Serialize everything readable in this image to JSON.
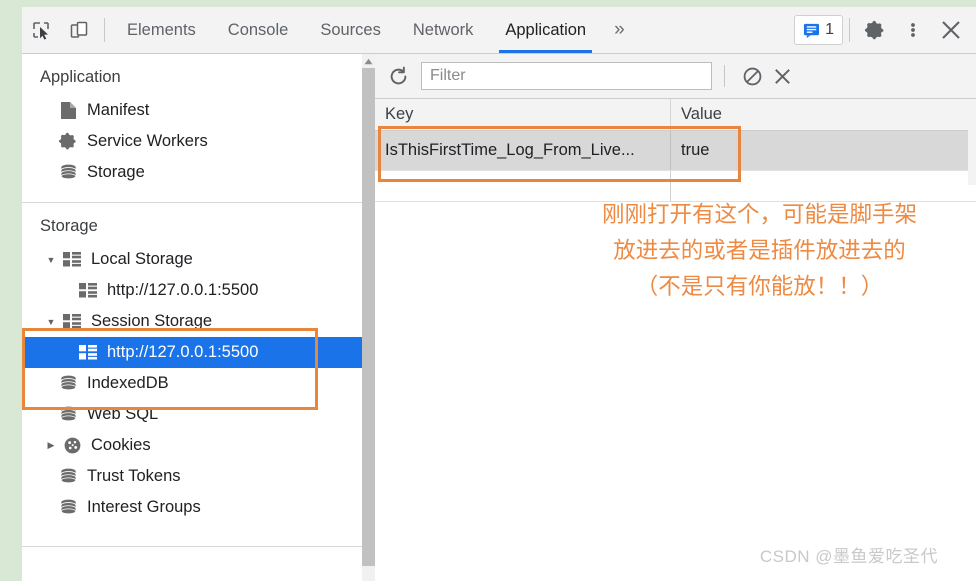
{
  "tabbar": {
    "icons": [
      {
        "name": "inspect-element-icon"
      },
      {
        "name": "device-toolbar-icon"
      }
    ],
    "tabs": [
      {
        "label": "Elements",
        "active": false
      },
      {
        "label": "Console",
        "active": false
      },
      {
        "label": "Sources",
        "active": false
      },
      {
        "label": "Network",
        "active": false
      },
      {
        "label": "Application",
        "active": true
      }
    ],
    "more_tabs_glyph": "»",
    "issues_count": "1",
    "right_icons": [
      {
        "name": "settings-gear-icon"
      },
      {
        "name": "more-options-icon"
      },
      {
        "name": "close-devtools-icon"
      }
    ]
  },
  "sidebar": {
    "application_title": "Application",
    "application_items": [
      {
        "label": "Manifest",
        "icon": "manifest-file-icon"
      },
      {
        "label": "Service Workers",
        "icon": "gear-icon"
      },
      {
        "label": "Storage",
        "icon": "database-icon"
      }
    ],
    "storage_title": "Storage",
    "storage_items": [
      {
        "label": "Local Storage",
        "icon": "table-grid-icon",
        "arrow": "▼",
        "indent": 0,
        "selected": false
      },
      {
        "label": "http://127.0.0.1:5500",
        "icon": "table-grid-icon",
        "arrow": "",
        "indent": 1,
        "selected": false
      },
      {
        "label": "Session Storage",
        "icon": "table-grid-icon",
        "arrow": "▼",
        "indent": 0,
        "selected": false
      },
      {
        "label": "http://127.0.0.1:5500",
        "icon": "table-grid-icon",
        "arrow": "",
        "indent": 1,
        "selected": true
      },
      {
        "label": "IndexedDB",
        "icon": "database-icon",
        "arrow": "",
        "indent": 0,
        "selected": false
      },
      {
        "label": "Web SQL",
        "icon": "database-icon",
        "arrow": "",
        "indent": 0,
        "selected": false
      },
      {
        "label": "Cookies",
        "icon": "cookie-icon",
        "arrow": "▶",
        "indent": 0,
        "selected": false
      },
      {
        "label": "Trust Tokens",
        "icon": "database-icon",
        "arrow": "",
        "indent": 0,
        "selected": false
      },
      {
        "label": "Interest Groups",
        "icon": "database-icon",
        "arrow": "",
        "indent": 0,
        "selected": false
      }
    ]
  },
  "main": {
    "toolbar": {
      "refresh_icon": "refresh-icon",
      "filter_value": "",
      "filter_placeholder": "Filter",
      "clear_all_icon": "clear-all-icon",
      "delete_selected_icon": "delete-selected-icon"
    },
    "table": {
      "columns": [
        "Key",
        "Value"
      ],
      "rows": [
        {
          "key": "IsThisFirstTime_Log_From_Live...",
          "value": "true",
          "selected": true
        }
      ]
    }
  },
  "annotation": {
    "text": "刚刚打开有这个，可能是脚手架\n放进去的或者是插件放进去的\n（不是只有你能放！！）",
    "color": "#ed8a43"
  },
  "watermark": {
    "text": "CSDN @墨鱼爱吃圣代"
  },
  "colors": {
    "accent_blue": "#1a73e8",
    "annotation_orange": "#e8863c",
    "panel_bg": "#f3f3f3",
    "selected_row_gray": "#d8d8d8",
    "outer_bg": "#d9e8d4"
  }
}
